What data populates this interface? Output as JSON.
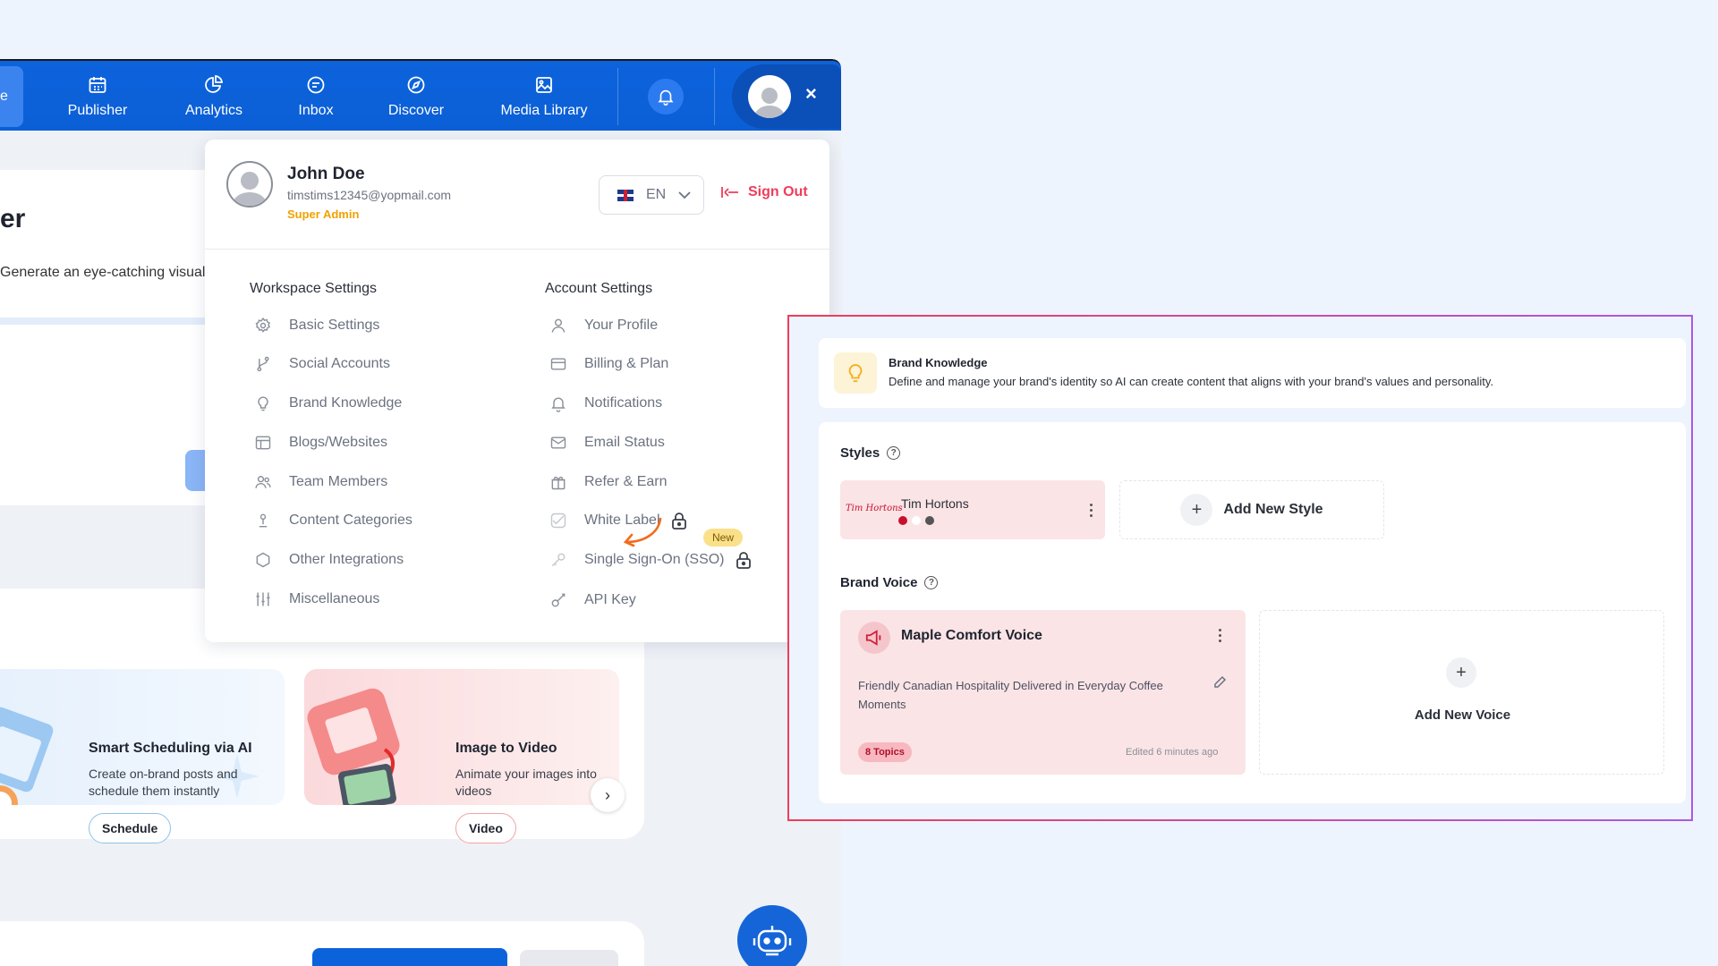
{
  "nav": {
    "stub_label": "e",
    "items": [
      {
        "label": "Publisher",
        "icon": "calendar-icon"
      },
      {
        "label": "Analytics",
        "icon": "pie-chart-icon"
      },
      {
        "label": "Inbox",
        "icon": "chat-icon"
      },
      {
        "label": "Discover",
        "icon": "compass-icon"
      },
      {
        "label": "Media Library",
        "icon": "image-gallery-icon"
      }
    ],
    "close": "×"
  },
  "background": {
    "heading": "er",
    "subtitle": "Generate an eye-catching visual",
    "promos": [
      {
        "title": "Smart Scheduling via AI",
        "desc": "Create on-brand posts and schedule them instantly",
        "button": "Schedule"
      },
      {
        "title": "Image to Video",
        "desc": "Animate your images into videos",
        "button": "Video"
      }
    ]
  },
  "profile": {
    "name": "John Doe",
    "email": "timstims12345@yopmail.com",
    "role": "Super Admin",
    "language": "EN",
    "sign_out": "Sign Out"
  },
  "workspace": {
    "title": "Workspace Settings",
    "items": [
      "Basic Settings",
      "Social Accounts",
      "Brand Knowledge",
      "Blogs/Websites",
      "Team Members",
      "Content Categories",
      "Other Integrations",
      "Miscellaneous"
    ]
  },
  "account": {
    "title": "Account Settings",
    "items": [
      "Your Profile",
      "Billing & Plan",
      "Notifications",
      "Email Status",
      "Refer & Earn",
      "White Label",
      "Single Sign-On (SSO)",
      "API Key"
    ],
    "new_badge": "New"
  },
  "brand_knowledge": {
    "title": "Brand Knowledge",
    "description": "Define and manage your brand's identity so AI can create content that aligns with your brand's values and personality.",
    "styles_label": "Styles",
    "style": {
      "logo_text": "Tim Hortons",
      "name": "Tim Hortons",
      "colors": [
        "#c8102e",
        "#ffffff",
        "#555555"
      ]
    },
    "add_style": "Add New Style",
    "voice_label": "Brand Voice",
    "voice": {
      "name": "Maple Comfort Voice",
      "description": "Friendly Canadian Hospitality Delivered in Everyday Coffee Moments",
      "topics": "8 Topics",
      "edited": "Edited 6 minutes ago"
    },
    "add_voice": "Add New Voice"
  }
}
